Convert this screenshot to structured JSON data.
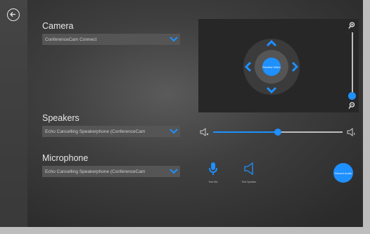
{
  "camera": {
    "label": "Camera",
    "selected": "ConferenceCam Connect"
  },
  "speakers": {
    "label": "Speakers",
    "selected": "Echo Cancelling Speakerphone (ConferenceCam",
    "volume_fraction": 0.49
  },
  "microphone": {
    "label": "Microphone",
    "selected": "Echo Cancelling Speakerphone (ConferenceCam"
  },
  "preview": {
    "button_label": "Preview Video",
    "zoom_fraction": 0.0
  },
  "tests": {
    "mic_caption": "Test Mic",
    "speaker_caption": "Test Speaker",
    "record_label": "Record Audio"
  },
  "icons": {
    "back": "back-arrow-circle-icon",
    "zoom_in": "zoom-in-icon",
    "zoom_out": "zoom-out-icon",
    "volume_low": "speaker-low-icon",
    "volume_high": "speaker-high-icon",
    "mic": "microphone-icon",
    "speaker": "speaker-outline-icon"
  },
  "colors": {
    "accent": "#1e90ff",
    "panel": "#272727",
    "dropdown": "#555555"
  }
}
